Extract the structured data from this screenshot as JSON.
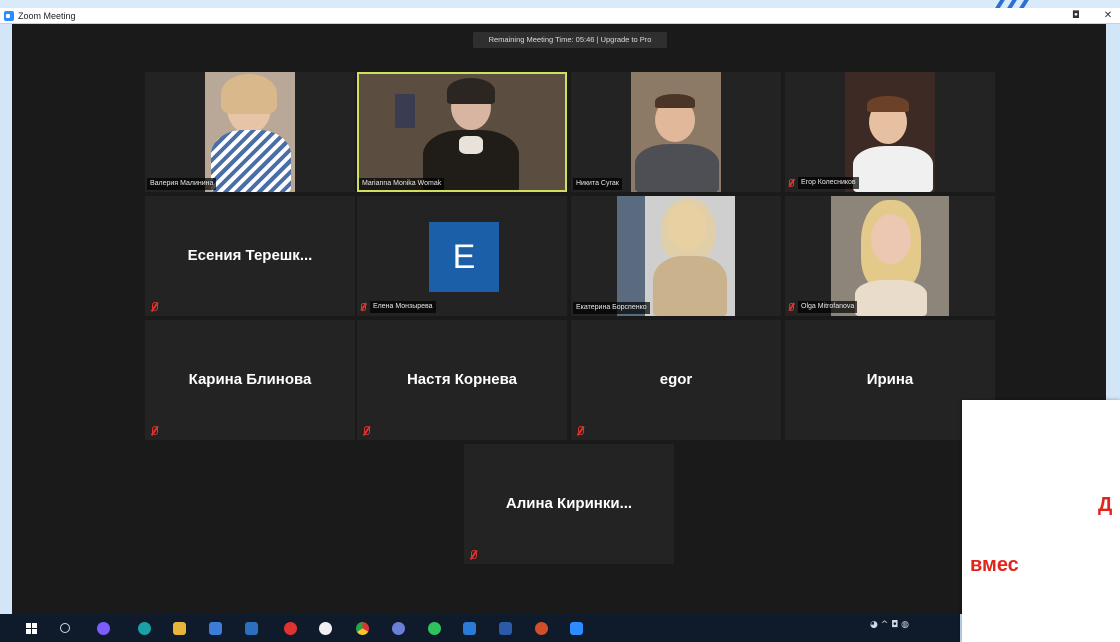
{
  "window": {
    "title": "Zoom Meeting",
    "restore_glyph": "◘",
    "close_glyph": "✕"
  },
  "banner": {
    "text": "Remaining Meeting Time: 05:46 | Upgrade to Pro"
  },
  "participants_video": [
    {
      "name": "Валерия Малинина"
    },
    {
      "name": "Marianna Monika Womak"
    },
    {
      "name": "Никита Сугак"
    },
    {
      "name": "Егор Колесников"
    }
  ],
  "row2": {
    "esenia": {
      "display_name": "Есения  Терешк..."
    },
    "elena": {
      "avatar_letter": "E",
      "name": "Елена Монзырева"
    },
    "ekaterina": {
      "name": "Екатерина Борспенко"
    },
    "olga": {
      "name": "Olga Mitrofanova"
    }
  },
  "row3": [
    {
      "display_name": "Карина Блинова"
    },
    {
      "display_name": "Настя Корнева"
    },
    {
      "display_name": "egor"
    },
    {
      "display_name": "Ирина"
    }
  ],
  "row4": {
    "display_name": "Алина  Киринки..."
  },
  "overlay": {
    "line1": "Д",
    "line2": "вмес"
  },
  "taskbar": {
    "apps": [
      "start-icon",
      "search-icon",
      "cortana-icon",
      "edge-icon",
      "file-explorer-icon",
      "store-icon",
      "network-icon",
      "yandex-icon",
      "yandex-browser-icon",
      "chrome-icon",
      "vk-icon",
      "whatsapp-icon",
      "mail-icon",
      "word-icon",
      "powerpoint-icon",
      "zoom-icon"
    ],
    "tray_text": "◕ ^ ◘ ◍"
  },
  "colors": {
    "accent_speaker": "#cfe060",
    "mute_red": "#e0332f",
    "avatar_blue": "#1a5fa8",
    "overlay_red": "#e0261c"
  }
}
